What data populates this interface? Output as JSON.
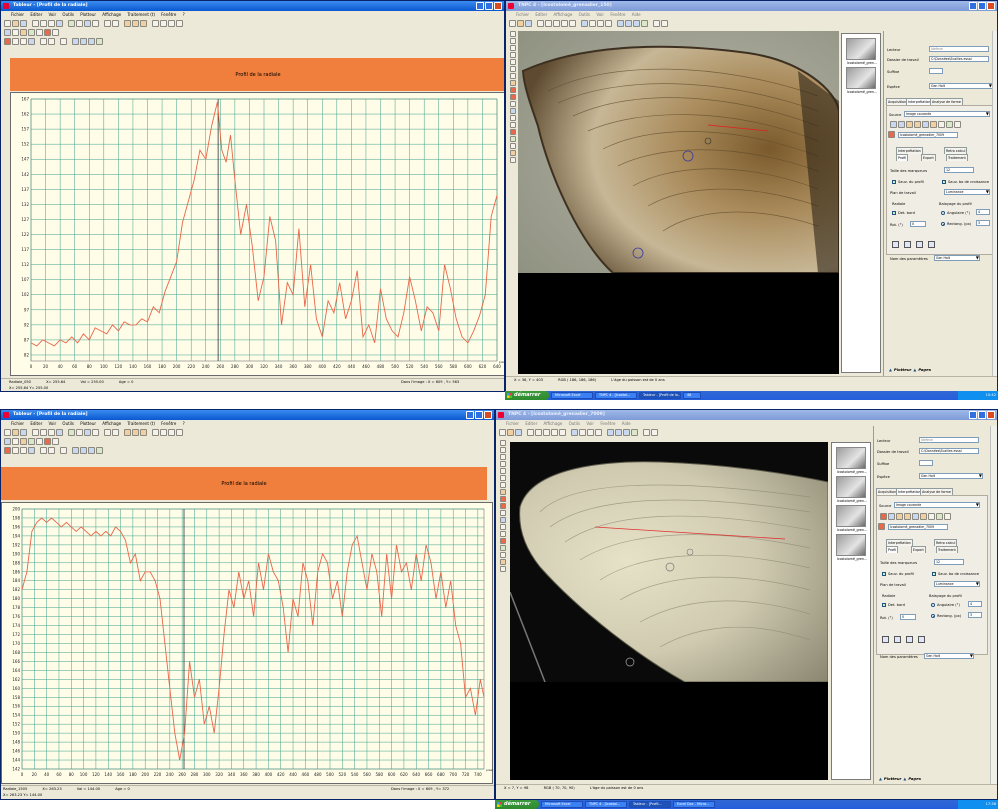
{
  "screen1": {
    "left_window": {
      "title": "Tableur - [Profil de la radiale]",
      "menu": [
        "Fichier",
        "Editer",
        "Voir",
        "Outils",
        "Plotteur",
        "Affichage",
        "Traitement (t)",
        "Fenêtre",
        "?"
      ],
      "banner": "Profil de la radiale",
      "status": [
        "Radiale_050",
        "X= 255.64",
        "Val = 255.00",
        "Age = 0"
      ],
      "status2": [
        "X= 255.64  Y= 255.00"
      ],
      "status_right": [
        "Dans l'image : X = 609 , Y= 563",
        "NUM"
      ]
    },
    "right_window": {
      "title": "TNPC 4 - [Icostolomé_grenadier_150]",
      "menu": [
        "Fichier",
        "Editer",
        "Affichage",
        "Outils",
        "Voir",
        "Fenêtre",
        "Aide"
      ],
      "status": [
        "X = 36, Y = 403",
        "RGB ( 186, 186, 186)",
        "L'âge du poisson est de 0 ans"
      ],
      "thumbs": [
        "Icostolomé_gren...",
        "Icostolomé_gren..."
      ]
    },
    "panel": {
      "lecteur_label": "Lecteur",
      "lecteur_value": "Jdefeve",
      "dossier_label": "Dossier de travail",
      "dossier_value": "C:\\Données\\Ecailles essai",
      "suffixe_label": "Suffixe",
      "suffixe_value": "",
      "espèce_label": "Espèce",
      "espèce_value": "Gen Holt",
      "tabs": [
        "Acquisition",
        "Interprétation",
        "Analyse de forme"
      ],
      "source_label": "Source",
      "source_value": "Image courante",
      "image_name": "Icostolomé_grenadier_7009",
      "subtabs": [
        "Interprétation",
        "Retro calcul"
      ],
      "subtabs2": [
        "Profil",
        "Export",
        "Traitement"
      ],
      "taille_label": "Taille des marqueurs",
      "taille_value": "12",
      "chk1": "Sauv. du profil",
      "chk2": "Sauv. bo de croissance",
      "plan_label": "Plan de travail",
      "plan_value": "Luminance",
      "radiale_label": "Radiale",
      "det_bord": "Det. bord",
      "rot_label": "Rot. (°)",
      "rot_value": "0",
      "balayage_label": "Balayage du profil",
      "angulaire": "Angulaire (°)",
      "angulaire_value": "4",
      "rectang": "Rectang. (px)",
      "rectang_value": "3",
      "nom_label": "Nom des paramètres",
      "nom_value": "Gen Holt",
      "bottom_tabs": [
        "Plotteur",
        "Pages"
      ]
    },
    "taskbar": {
      "start": "démarrer",
      "items": [
        "Microsoft Excel",
        "TNPC 4 - [Icostol...",
        "Tableur - [Profil de la...",
        "46"
      ],
      "tray": "10:42"
    },
    "chart_data": {
      "type": "line",
      "xlim": [
        0,
        640
      ],
      "ylim": [
        80,
        167
      ],
      "xticks": [
        0,
        20,
        40,
        60,
        80,
        100,
        120,
        140,
        160,
        180,
        200,
        220,
        240,
        260,
        280,
        300,
        320,
        340,
        360,
        380,
        400,
        420,
        440,
        460,
        480,
        500,
        520,
        540,
        560,
        580,
        600,
        620,
        640
      ],
      "yticks": [
        82,
        87,
        92,
        97,
        102,
        107,
        112,
        117,
        122,
        127,
        132,
        137,
        142,
        147,
        152,
        157,
        162,
        167
      ],
      "xunit": "pixel",
      "cursor_x": 257,
      "color": "#e8664a",
      "series": [
        {
          "x": [
            0,
            8,
            16,
            24,
            32,
            40,
            48,
            56,
            64,
            72,
            80,
            88,
            96,
            104,
            112,
            120,
            128,
            136,
            144,
            152,
            160,
            168,
            176,
            184,
            192,
            200,
            208,
            216,
            224,
            232,
            240,
            248,
            256,
            262,
            268,
            274,
            280,
            288,
            296,
            304,
            312,
            320,
            328,
            336,
            344,
            352,
            360,
            368,
            376,
            384,
            392,
            400,
            408,
            416,
            424,
            432,
            440,
            448,
            456,
            464,
            472,
            480,
            488,
            496,
            504,
            512,
            520,
            528,
            536,
            544,
            552,
            560,
            568,
            576,
            584,
            592,
            600,
            608,
            616,
            624,
            632,
            640
          ],
          "y": [
            86,
            85,
            87,
            86,
            85,
            87,
            86,
            88,
            86,
            89,
            87,
            91,
            90,
            89,
            92,
            90,
            93,
            92,
            92,
            94,
            93,
            98,
            96,
            103,
            108,
            113,
            126,
            133,
            140,
            150,
            147,
            158,
            166,
            150,
            146,
            155,
            140,
            122,
            132,
            118,
            100,
            108,
            128,
            120,
            92,
            106,
            102,
            124,
            98,
            112,
            94,
            88,
            100,
            96,
            106,
            94,
            100,
            110,
            88,
            92,
            86,
            104,
            94,
            90,
            88,
            96,
            108,
            100,
            90,
            98,
            96,
            90,
            112,
            104,
            94,
            88,
            86,
            90,
            95,
            102,
            128,
            135,
            124,
            132,
            120,
            108
          ]
        }
      ]
    }
  },
  "screen2": {
    "left_window": {
      "title": "Tableur - [Profil de la radiale]",
      "menu": [
        "Fichier",
        "Editer",
        "Voir",
        "Outils",
        "Plotteur",
        "Affichage",
        "Traitement (t)",
        "Fenêtre",
        "?"
      ],
      "banner": "Profil de la radiale",
      "status": [
        "Radiale_1505",
        "X= 263.23",
        "Val = 144.00",
        "Age = 0"
      ],
      "status2": [
        "X= 263.23  Y= 144.00"
      ],
      "status_right": [
        "Dans l'image : X = 609 , Y= 372",
        "NUM"
      ]
    },
    "right_window": {
      "title": "TNPC 4 - [Icostolomé_grenadier_7009]",
      "menu": [
        "Fichier",
        "Editer",
        "Affichage",
        "Outils",
        "Voir",
        "Fenêtre",
        "Aide"
      ],
      "status": [
        "X = 7, Y = 98",
        "RGB ( 70, 70, 90)",
        "L'âge du poisson est de 0 ans"
      ],
      "thumbs": [
        "Icostolomé_gren...",
        "Icostolomé_gren...",
        "Icostolomé_gren...",
        "Icostolomé_gren..."
      ]
    },
    "panel": {
      "lecteur_label": "Lecteur",
      "lecteur_value": "Jdefeve",
      "dossier_label": "Dossier de travail",
      "dossier_value": "C:\\Données\\Ecailles essai",
      "suffixe_label": "Suffixe",
      "suffixe_value": "",
      "espèce_label": "Espèce",
      "espèce_value": "Gen Holt",
      "tabs": [
        "Acquisition",
        "Interprétation",
        "Analyse de forme"
      ],
      "source_label": "Source",
      "source_value": "Image courante",
      "image_name": "Icostolomé_grenadier_7009",
      "subtabs": [
        "Interprétation",
        "Retro calcul"
      ],
      "subtabs2": [
        "Profil",
        "Export",
        "Traitement"
      ],
      "taille_label": "Taille des marqueurs",
      "taille_value": "12",
      "chk1": "Sauv. du profil",
      "chk2": "Sauv. bo de croissance",
      "plan_label": "Plan de travail",
      "plan_value": "Luminance",
      "radiale_label": "Radiale",
      "det_bord": "Det. bord",
      "rot_label": "Rot. (°)",
      "rot_value": "0",
      "balayage_label": "Balayage du profil",
      "angulaire": "Angulaire (°)",
      "angulaire_value": "4",
      "rectang": "Rectang. (px)",
      "rectang_value": "3",
      "nom_label": "Nom des paramètres",
      "nom_value": "Gen Holt",
      "bottom_tabs": [
        "Plotteur",
        "Pages"
      ]
    },
    "taskbar": {
      "start": "démarrer",
      "items": [
        "Microsoft Excel",
        "TNPC 4 - [Icostol...",
        "Tableur - [Profil...",
        "Excel Doc - Micro..."
      ],
      "tray": "17:36"
    },
    "chart_data": {
      "type": "line",
      "xlim": [
        0,
        750
      ],
      "ylim": [
        142,
        200
      ],
      "xticks": [
        0,
        20,
        40,
        60,
        80,
        100,
        120,
        140,
        160,
        180,
        200,
        220,
        240,
        260,
        280,
        300,
        320,
        340,
        360,
        380,
        400,
        420,
        440,
        460,
        480,
        500,
        520,
        540,
        560,
        580,
        600,
        620,
        640,
        660,
        680,
        700,
        720,
        740
      ],
      "yticks": [
        142,
        144,
        146,
        148,
        150,
        152,
        154,
        156,
        158,
        160,
        162,
        164,
        166,
        168,
        170,
        172,
        174,
        176,
        178,
        180,
        182,
        184,
        186,
        188,
        190,
        192,
        194,
        196,
        198,
        200
      ],
      "xunit": "pixel",
      "cursor_x": 263,
      "color": "#e8664a",
      "series": [
        {
          "x": [
            0,
            8,
            16,
            24,
            32,
            40,
            48,
            56,
            64,
            72,
            80,
            88,
            96,
            104,
            112,
            120,
            128,
            136,
            144,
            152,
            160,
            168,
            176,
            184,
            192,
            200,
            208,
            216,
            224,
            232,
            240,
            248,
            256,
            264,
            272,
            280,
            288,
            296,
            304,
            312,
            320,
            328,
            336,
            344,
            352,
            360,
            368,
            376,
            384,
            392,
            400,
            408,
            416,
            424,
            432,
            440,
            448,
            456,
            464,
            472,
            480,
            488,
            496,
            504,
            512,
            520,
            528,
            536,
            544,
            552,
            560,
            568,
            576,
            584,
            592,
            600,
            608,
            616,
            624,
            632,
            640,
            648,
            656,
            664,
            672,
            680,
            688,
            696,
            704,
            712,
            720,
            728,
            736,
            744,
            750
          ],
          "y": [
            182,
            186,
            195,
            197,
            198,
            197,
            198,
            197,
            196,
            197,
            196,
            195,
            196,
            195,
            194,
            195,
            194,
            195,
            194,
            196,
            195,
            193,
            188,
            190,
            184,
            186,
            186,
            184,
            180,
            170,
            160,
            150,
            144,
            150,
            166,
            158,
            162,
            152,
            156,
            150,
            160,
            172,
            182,
            178,
            186,
            180,
            184,
            176,
            188,
            182,
            190,
            186,
            184,
            178,
            168,
            180,
            176,
            188,
            184,
            174,
            186,
            190,
            188,
            180,
            184,
            176,
            186,
            192,
            194,
            188,
            182,
            190,
            186,
            176,
            190,
            180,
            192,
            186,
            188,
            182,
            190,
            184,
            192,
            188,
            180,
            186,
            178,
            184,
            174,
            170,
            158,
            160,
            154,
            162,
            158
          ]
        }
      ]
    }
  }
}
